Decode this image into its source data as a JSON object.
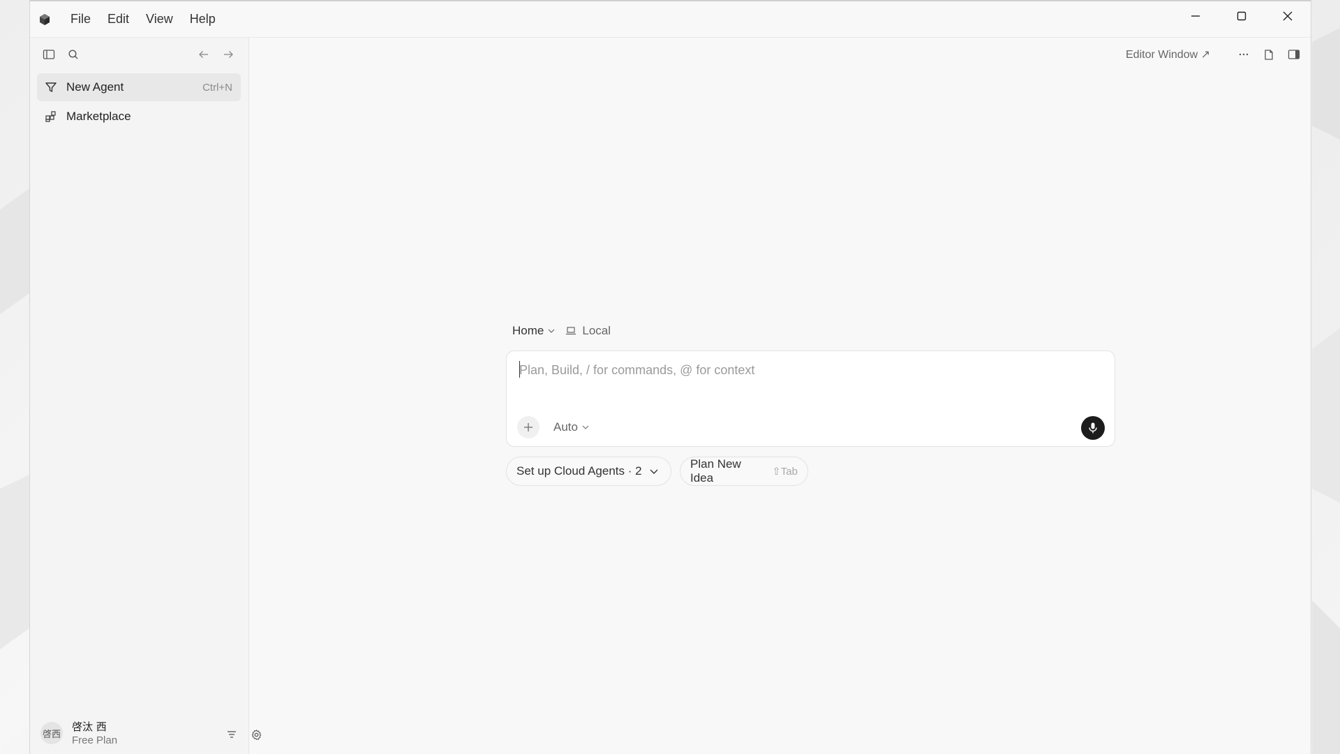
{
  "menu": {
    "items": [
      {
        "label": "File"
      },
      {
        "label": "Edit"
      },
      {
        "label": "View"
      },
      {
        "label": "Help"
      }
    ]
  },
  "sidebar": {
    "items": [
      {
        "label": "New Agent",
        "shortcut": "Ctrl+N",
        "icon": "funnel-icon",
        "active": true
      },
      {
        "label": "Marketplace",
        "icon": "grid-add-icon",
        "active": false
      }
    ],
    "user": {
      "avatar_text": "啓西",
      "name": "啓汰 西",
      "plan": "Free Plan"
    }
  },
  "main": {
    "editor_window_label": "Editor Window ↗",
    "composer": {
      "location": "Home",
      "environment": "Local",
      "placeholder": "Plan, Build, / for commands, @ for context",
      "value": "",
      "mode": "Auto"
    },
    "chips": [
      {
        "label": "Set up Cloud Agents · 2"
      },
      {
        "label": "Plan New Idea",
        "hint": "⇧Tab"
      }
    ]
  },
  "colors": {
    "mic_button": "#1c1c1c",
    "active_item_bg": "#e8e8e8"
  }
}
